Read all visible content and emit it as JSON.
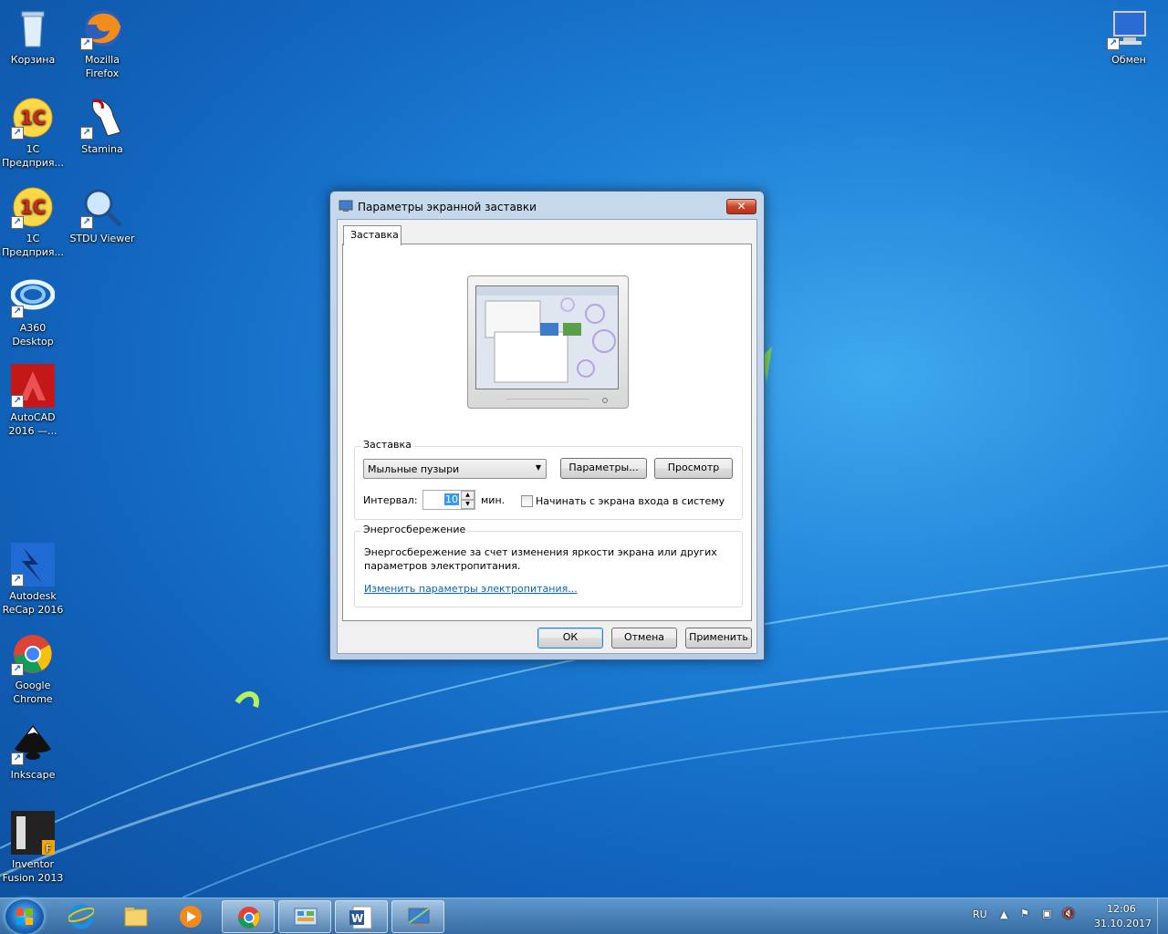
{
  "desktop": {
    "icons": [
      {
        "label": "Корзина",
        "icon": "recycle-bin-icon"
      },
      {
        "label": "Mozilla Firefox",
        "icon": "firefox-icon"
      },
      {
        "label": "1C Предприя...",
        "icon": "1c-icon"
      },
      {
        "label": "Stamina",
        "icon": "stamina-icon"
      },
      {
        "label": "1C Предприя...",
        "icon": "1c-icon"
      },
      {
        "label": "STDU Viewer",
        "icon": "stdu-viewer-icon"
      },
      {
        "label": "A360 Desktop",
        "icon": "a360-icon"
      },
      {
        "label": "AutoCAD 2016 —...",
        "icon": "autocad-icon"
      },
      {
        "label": "Autodesk ReCap 2016",
        "icon": "recap-icon"
      },
      {
        "label": "Google Chrome",
        "icon": "chrome-icon"
      },
      {
        "label": "Inkscape",
        "icon": "inkscape-icon"
      },
      {
        "label": "Inventor Fusion 2013",
        "icon": "inventor-fusion-icon"
      },
      {
        "label": "Обмен",
        "icon": "network-computer-icon"
      }
    ]
  },
  "dialog": {
    "title": "Параметры экранной заставки",
    "tab_label": "Заставка",
    "screensaver": {
      "legend": "Заставка",
      "selected": "Мыльные пузыри",
      "params_button": "Параметры...",
      "preview_button": "Просмотр",
      "interval_label": "Интервал:",
      "interval_value": "10",
      "interval_unit": "мин.",
      "logon_checkbox_label": "Начинать с экрана входа в систему",
      "logon_checked": false
    },
    "power": {
      "legend": "Энергосбережение",
      "description_line1": "Энергосбережение за счет изменения яркости экрана или других",
      "description_line2": "параметров электропитания.",
      "link": "Изменить параметры электропитания..."
    },
    "buttons": {
      "ok": "ОК",
      "cancel": "Отмена",
      "apply": "Применить"
    }
  },
  "taskbar": {
    "pinned": [
      "internet-explorer-icon",
      "explorer-folder-icon",
      "media-player-icon",
      "chrome-icon",
      "control-panel-icon",
      "word-icon",
      "screensaver-settings-icon"
    ],
    "language": "RU",
    "time": "12:06",
    "date": "31.10.2017"
  }
}
